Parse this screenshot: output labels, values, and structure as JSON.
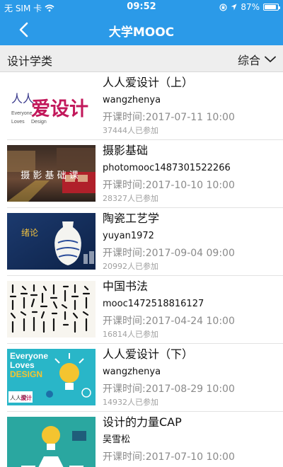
{
  "status_bar": {
    "carrier": "无 SIM 卡",
    "time": "09:52",
    "battery": "87%",
    "battery_level": 0.87
  },
  "nav": {
    "title": "大学MOOC",
    "back_icon": "chevron-left-icon"
  },
  "filter": {
    "category": "设计学类",
    "sort_label": "综合"
  },
  "courses": [
    {
      "name": "人人爱设计（上）",
      "author": "wangzhenya",
      "time": "开课时间:2017-07-11 10:00",
      "count": "37444人已参加",
      "thumb": {
        "line1": "人人",
        "big": "爱设计",
        "sub1": "Everyone",
        "sub2": "Loves",
        "sub3": "Design"
      }
    },
    {
      "name": "摄影基础",
      "author": "photomooc1487301522266",
      "time": "开课时间:2017-10-10 10:00",
      "count": "28327人已参加",
      "thumb": {
        "text": "摄 影 基 础 课"
      }
    },
    {
      "name": "陶瓷工艺学",
      "author": "yuyan1972",
      "time": "开课时间:2017-09-04 09:00",
      "count": "20992人已参加",
      "thumb": {
        "text": "绪论"
      }
    },
    {
      "name": "中国书法",
      "author": "mooc1472518816127",
      "time": "开课时间:2017-04-24 10:00",
      "count": "16814人已参加",
      "thumb": {}
    },
    {
      "name": "人人爱设计（下）",
      "author": "wangzhenya",
      "time": "开课时间:2017-08-29 10:00",
      "count": "14932人已参加",
      "thumb": {
        "l1": "Everyone",
        "l2": "Loves",
        "l3": "DESIGN",
        "badge1": "人人爱",
        "badge2": "设计"
      }
    },
    {
      "name": "设计的力量CAP",
      "author": "吴雪松",
      "time": "开课时间:2017-07-10 10:00",
      "count": "",
      "thumb": {}
    }
  ]
}
